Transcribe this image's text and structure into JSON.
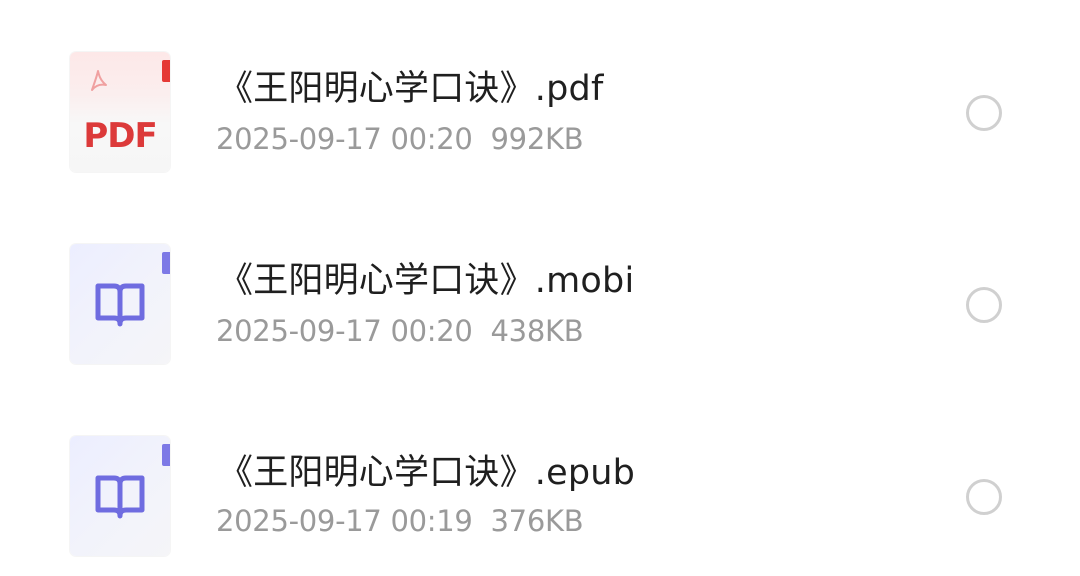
{
  "files": [
    {
      "name": "《王阳明心学口诀》.pdf",
      "date": "2025-09-17 00:20",
      "size": "992KB",
      "type": "pdf",
      "type_label": "PDF",
      "icon": "pdf-file-icon",
      "accent": "#e53935",
      "selected": false
    },
    {
      "name": "《王阳明心学口诀》.mobi",
      "date": "2025-09-17 00:20",
      "size": "438KB",
      "type": "mobi",
      "icon": "ebook-file-icon",
      "accent": "#6f6ce0",
      "selected": false
    },
    {
      "name": "《王阳明心学口诀》.epub",
      "date": "2025-09-17 00:19",
      "size": "376KB",
      "type": "epub",
      "icon": "ebook-file-icon",
      "accent": "#6f6ce0",
      "selected": false
    }
  ],
  "colors": {
    "name_text": "#1f1f1f",
    "meta_text": "#9a9a9a",
    "radio_border": "#d0d0d0",
    "pdf_red": "#dc3a3a",
    "book_purple": "#6f6ce0"
  }
}
